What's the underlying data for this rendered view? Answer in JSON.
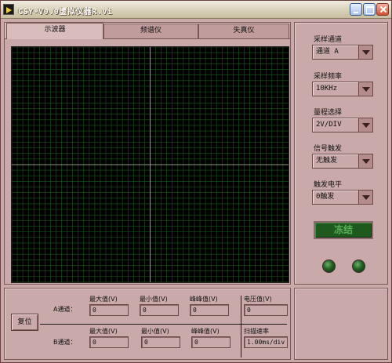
{
  "window": {
    "title": "CSY-V0.0虚拟仪器R.vi"
  },
  "tabs": [
    {
      "label": "示波器",
      "active": true
    },
    {
      "label": "频谱仪",
      "active": false
    },
    {
      "label": "失真仪",
      "active": false
    }
  ],
  "scope": {
    "background": "#000000",
    "grid_color": "#1d5a1d",
    "axis_color": "#b8b89a"
  },
  "controls": {
    "channel": {
      "label": "采样通道",
      "value": "通道 A"
    },
    "rate": {
      "label": "采样频率",
      "value": "10KHz"
    },
    "range": {
      "label": "量程选择",
      "value": "2V/DIV"
    },
    "trigger": {
      "label": "信号触发",
      "value": "无触发"
    },
    "trigger_level": {
      "label": "触发电平",
      "value": "0触发"
    },
    "freeze": {
      "label": "冻结"
    }
  },
  "measure": {
    "reset_label": "复位",
    "channel_a": {
      "label": "A通道：",
      "max_label": "最大值(V)",
      "max_value": "0",
      "min_label": "最小值(V)",
      "min_value": "0",
      "pp_label": "峰峰值(V)",
      "pp_value": "0"
    },
    "channel_b": {
      "label": "B通道：",
      "max_label": "最大值(V)",
      "max_value": "0",
      "min_label": "最小值(V)",
      "min_value": "0",
      "pp_label": "峰峰值(V)",
      "pp_value": "0"
    },
    "voltage_label": "电压值(V)",
    "voltage_value": "0",
    "scan_label": "扫描速率",
    "scan_value": "1.00ms/div"
  }
}
